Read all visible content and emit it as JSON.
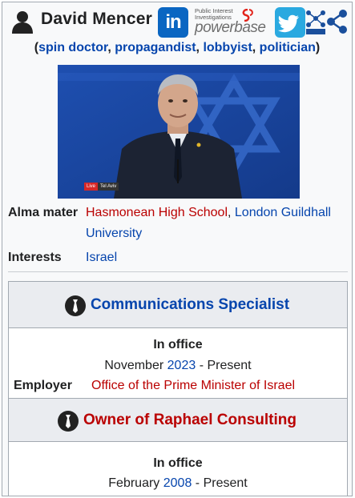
{
  "header": {
    "name": "David Mencer",
    "icons": [
      "person-icon",
      "linkedin-icon",
      "powerbase-logo",
      "twitter-icon",
      "rdf-icon",
      "graph-icon"
    ],
    "linkedin_label": "in",
    "powerbase_small": "Public Interest Investigations",
    "powerbase_big": "powerbase"
  },
  "roles": {
    "open": "(",
    "items": [
      "spin doctor",
      "propagandist",
      "lobbyist",
      "politician"
    ],
    "sep": ", ",
    "close": ")"
  },
  "photo": {
    "live": "Live",
    "location": "Tel Aviv"
  },
  "fields": {
    "alma_mater_label": "Alma mater",
    "alma_mater_1": "Hasmonean High School",
    "alma_mater_sep": ", ",
    "alma_mater_2": "London Guildhall",
    "alma_mater_2b": "University",
    "interests_label": "Interests",
    "interests_value": "Israel"
  },
  "positions": [
    {
      "title": "Communications Specialist",
      "in_office": "In office",
      "start_month": "November",
      "start_year": "2023",
      "end": "- Present",
      "employer_label": "Employer",
      "employer": "Office of the Prime Minister of Israel"
    },
    {
      "title": "Owner of Raphael Consulting",
      "in_office": "In office",
      "start_month": "February",
      "start_year": "2008",
      "end": "- Present"
    }
  ],
  "colors": {
    "link_blue": "#0645ad",
    "link_red": "#ba0000",
    "border": "#a2a9b1",
    "linkedin": "#0a66c2",
    "twitter": "#2aa9e0"
  }
}
